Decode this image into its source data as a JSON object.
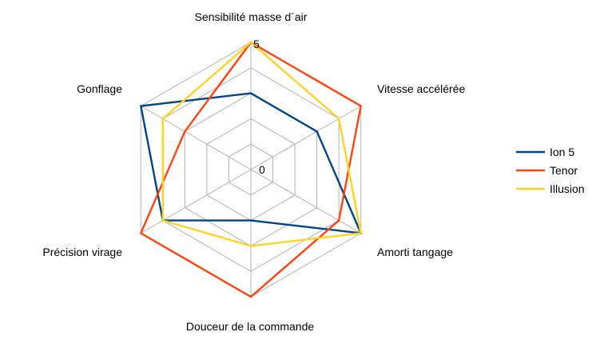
{
  "chart_data": {
    "type": "radar",
    "axes": [
      "Sensibilité masse d´air",
      "Vitesse accélérée",
      "Amorti tangage",
      "Douceur de la commande",
      "Précision virage",
      "Gonflage"
    ],
    "range": [
      0,
      5
    ],
    "tick_labels": [
      "0",
      "5"
    ],
    "grid": true,
    "legend_position": "right",
    "series": [
      {
        "name": "Ion 5",
        "color": "#004586",
        "values": [
          3,
          3,
          5,
          2,
          4,
          5
        ]
      },
      {
        "name": "Tenor",
        "color": "#ff420e",
        "values": [
          5,
          5,
          4,
          5,
          5,
          3
        ]
      },
      {
        "name": "Illusion",
        "color": "#ffd320",
        "values": [
          5,
          4,
          5,
          3,
          4,
          4
        ]
      }
    ]
  }
}
